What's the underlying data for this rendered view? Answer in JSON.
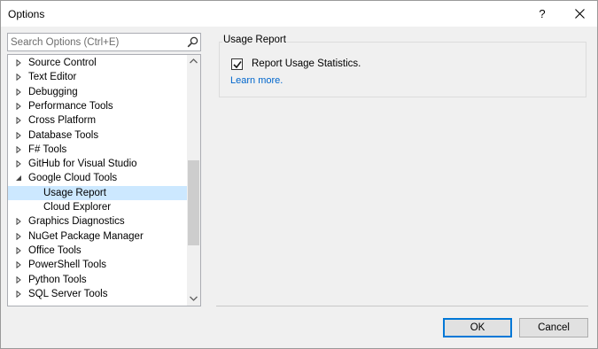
{
  "window": {
    "title": "Options",
    "help_label": "?"
  },
  "search": {
    "placeholder": "Search Options (Ctrl+E)"
  },
  "tree": {
    "items": [
      {
        "label": "Source Control",
        "level": 0,
        "expanded": false,
        "selected": false
      },
      {
        "label": "Text Editor",
        "level": 0,
        "expanded": false,
        "selected": false
      },
      {
        "label": "Debugging",
        "level": 0,
        "expanded": false,
        "selected": false
      },
      {
        "label": "Performance Tools",
        "level": 0,
        "expanded": false,
        "selected": false
      },
      {
        "label": "Cross Platform",
        "level": 0,
        "expanded": false,
        "selected": false
      },
      {
        "label": "Database Tools",
        "level": 0,
        "expanded": false,
        "selected": false
      },
      {
        "label": "F# Tools",
        "level": 0,
        "expanded": false,
        "selected": false
      },
      {
        "label": "GitHub for Visual Studio",
        "level": 0,
        "expanded": false,
        "selected": false
      },
      {
        "label": "Google Cloud Tools",
        "level": 0,
        "expanded": true,
        "selected": false
      },
      {
        "label": "Usage Report",
        "level": 1,
        "expanded": null,
        "selected": true
      },
      {
        "label": "Cloud Explorer",
        "level": 1,
        "expanded": null,
        "selected": false
      },
      {
        "label": "Graphics Diagnostics",
        "level": 0,
        "expanded": false,
        "selected": false
      },
      {
        "label": "NuGet Package Manager",
        "level": 0,
        "expanded": false,
        "selected": false
      },
      {
        "label": "Office Tools",
        "level": 0,
        "expanded": false,
        "selected": false
      },
      {
        "label": "PowerShell Tools",
        "level": 0,
        "expanded": false,
        "selected": false
      },
      {
        "label": "Python Tools",
        "level": 0,
        "expanded": false,
        "selected": false
      },
      {
        "label": "SQL Server Tools",
        "level": 0,
        "expanded": false,
        "selected": false
      }
    ],
    "scroll_position": 0.42
  },
  "panel": {
    "group_title": "Usage Report",
    "checkbox_label": "Report Usage Statistics.",
    "checkbox_checked": true,
    "link_label": "Learn more."
  },
  "buttons": {
    "ok_label": "OK",
    "cancel_label": "Cancel"
  },
  "colors": {
    "selection": "#cce8ff",
    "link": "#0066cc",
    "default_button_border": "#0078d7"
  }
}
